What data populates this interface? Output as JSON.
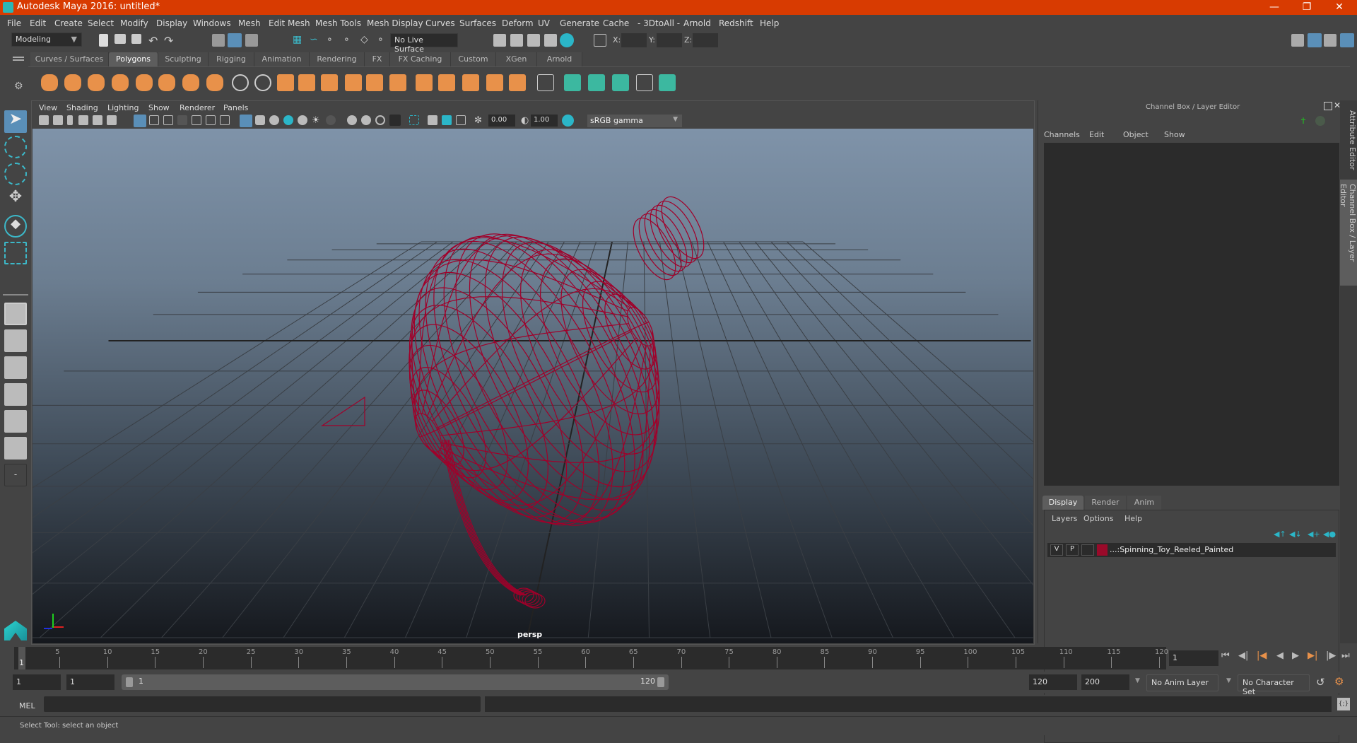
{
  "window": {
    "title": "Autodesk Maya 2016: untitled*",
    "controls": [
      "minimize-icon",
      "restore-icon",
      "close-icon"
    ]
  },
  "menubar": [
    "File",
    "Edit",
    "Create",
    "Select",
    "Modify",
    "Display",
    "Windows",
    "Mesh",
    "Edit Mesh",
    "Mesh Tools",
    "Mesh Display",
    "Curves",
    "Surfaces",
    "Deform",
    "UV",
    "Generate",
    "Cache",
    "- 3DtoAll -",
    "Arnold",
    "Redshift",
    "Help"
  ],
  "status_line": {
    "menu_set": "Modeling",
    "live_surface": "No Live Surface",
    "x_label": "X:",
    "y_label": "Y:",
    "z_label": "Z:",
    "x_value": "",
    "y_value": "",
    "z_value": ""
  },
  "shelf": {
    "tabs": [
      "Curves / Surfaces",
      "Polygons",
      "Sculpting",
      "Rigging",
      "Animation",
      "Rendering",
      "FX",
      "FX Caching",
      "Custom",
      "XGen",
      "Arnold"
    ],
    "active_tab": "Polygons",
    "accent_color": "#e8914a",
    "teal_color": "#3cb8a0"
  },
  "viewport": {
    "panel_menu": [
      "View",
      "Shading",
      "Lighting",
      "Show",
      "Renderer",
      "Panels"
    ],
    "exposure": "0.00",
    "gamma": "1.00",
    "color_space": "sRGB gamma",
    "camera_label": "persp",
    "wireframe_color": "#a0002a"
  },
  "channel_box": {
    "title": "Channel Box / Layer Editor",
    "menu": [
      "Channels",
      "Edit",
      "Object",
      "Show"
    ]
  },
  "layer_editor": {
    "tabs": [
      "Display",
      "Render",
      "Anim"
    ],
    "active_tab": "Display",
    "menu": [
      "Layers",
      "Options",
      "Help"
    ],
    "layers": [
      {
        "visible": "V",
        "playback": "P",
        "color": "#9a0a2a",
        "name": "...:Spinning_Toy_Reeled_Painted"
      }
    ]
  },
  "side_tabs": [
    "Attribute Editor",
    "Channel Box / Layer Editor"
  ],
  "timeline": {
    "ticks": [
      5,
      10,
      15,
      20,
      25,
      30,
      35,
      40,
      45,
      50,
      55,
      60,
      65,
      70,
      75,
      80,
      85,
      90,
      95,
      100,
      105,
      110,
      115,
      120
    ],
    "min": 1,
    "max": 120,
    "current_frame": "1",
    "current_frame_field": "1"
  },
  "range": {
    "start": "1",
    "playback_start": "1",
    "slider_start": "1",
    "slider_end": "120",
    "playback_end": "120",
    "end": "200",
    "anim_layer": "No Anim Layer",
    "character_set": "No Character Set"
  },
  "command_line": {
    "label": "MEL",
    "value": ""
  },
  "help_line": "Select Tool: select an object"
}
